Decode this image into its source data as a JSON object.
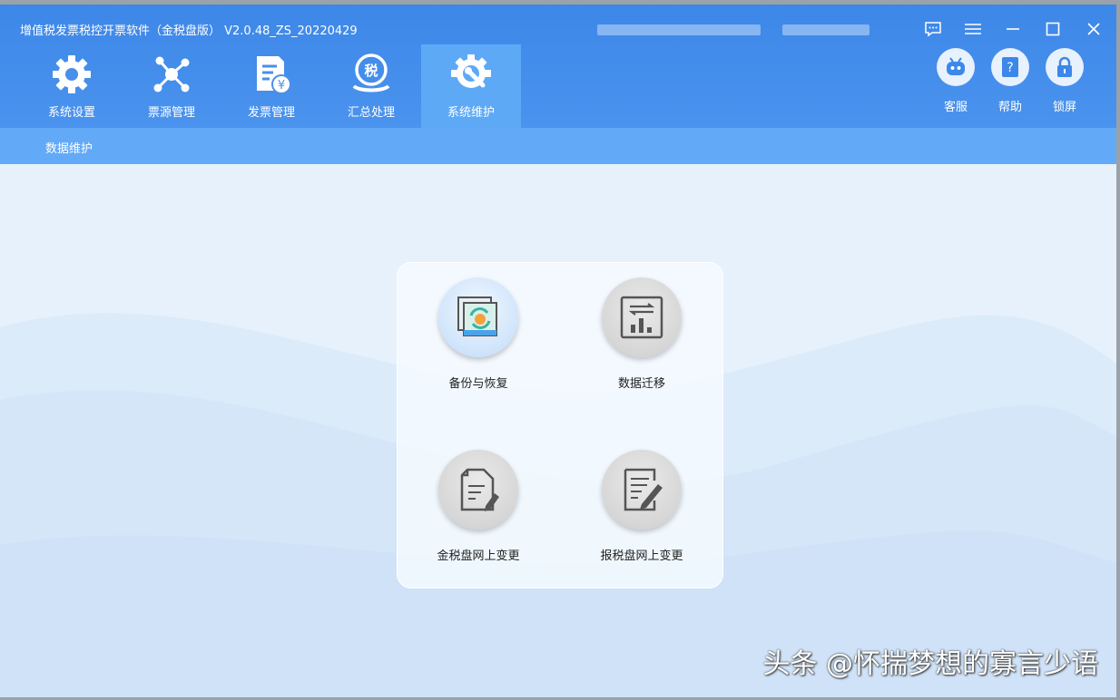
{
  "window": {
    "title": "增值税发票税控开票软件（金税盘版） V2.0.48_ZS_20220429"
  },
  "toolbar": {
    "tabs": [
      {
        "label": "系统设置",
        "icon": "gear-icon"
      },
      {
        "label": "票源管理",
        "icon": "network-icon"
      },
      {
        "label": "发票管理",
        "icon": "invoice-icon"
      },
      {
        "label": "汇总处理",
        "icon": "tax-summary-icon"
      },
      {
        "label": "系统维护",
        "icon": "wrench-gear-icon",
        "active": true
      }
    ],
    "side_buttons": [
      {
        "label": "客服",
        "icon": "robot-icon"
      },
      {
        "label": "帮助",
        "icon": "help-icon"
      },
      {
        "label": "锁屏",
        "icon": "lock-icon"
      }
    ]
  },
  "subnav": {
    "item": "数据维护"
  },
  "functions": [
    {
      "label": "备份与恢复",
      "icon": "backup-restore-icon"
    },
    {
      "label": "数据迁移",
      "icon": "data-migration-icon"
    },
    {
      "label": "金税盘网上变更",
      "icon": "document-edit-icon"
    },
    {
      "label": "报税盘网上变更",
      "icon": "form-edit-icon"
    }
  ],
  "watermark": "头条 @怀揣梦想的寡言少语",
  "colors": {
    "titlebar": "#4a93ee",
    "active_tab": "#5ea9f6",
    "subbar": "#62aaf7",
    "content_bg": "#e6f1fc"
  }
}
